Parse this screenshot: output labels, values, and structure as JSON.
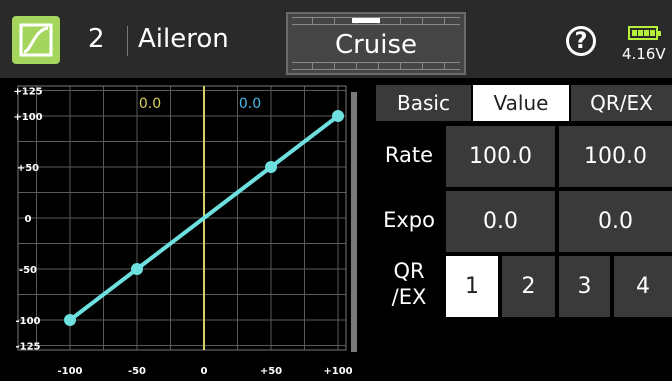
{
  "header": {
    "app_icon": "curve-icon",
    "channel_number": "2",
    "channel_name": "Aileron",
    "flight_mode": "Cruise",
    "help_icon": "?",
    "battery_voltage": "4.16V",
    "accent": "#a4d65e"
  },
  "graph": {
    "y_ticks": [
      "+125",
      "+100",
      "+50",
      "0",
      "-50",
      "-100",
      "-125"
    ],
    "x_ticks": [
      "-100",
      "-50",
      "0",
      "+50",
      "+100"
    ],
    "input_readout": "0.0",
    "output_readout": "0.0",
    "curve_color": "#6fe0e0",
    "center_line_color": "#d8d060",
    "points": [
      {
        "x": -100,
        "y": -100
      },
      {
        "x": -50,
        "y": -50
      },
      {
        "x": 50,
        "y": 50
      },
      {
        "x": 100,
        "y": 100
      }
    ]
  },
  "tabs": [
    "Basic",
    "Value",
    "QR/EX"
  ],
  "active_tab": "Value",
  "rows": {
    "rate": {
      "label": "Rate",
      "left": "100.0",
      "right": "100.0"
    },
    "expo": {
      "label": "Expo",
      "left": "0.0",
      "right": "0.0"
    },
    "qrex": {
      "label_line1": "QR",
      "label_line2": "/EX",
      "options": [
        "1",
        "2",
        "3",
        "4"
      ],
      "selected": "1"
    }
  }
}
